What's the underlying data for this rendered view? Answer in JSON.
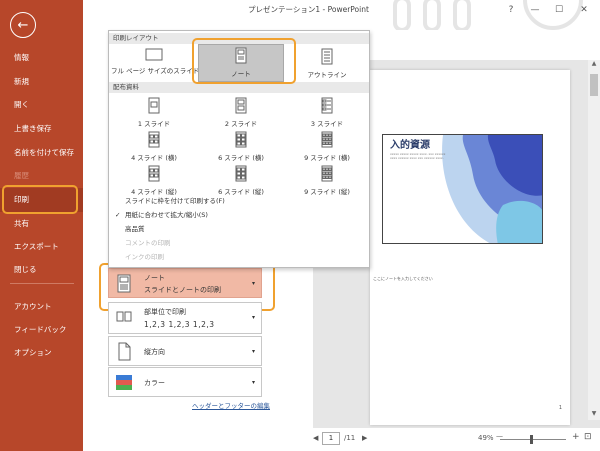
{
  "window": {
    "title": "プレゼンテーション1 - PowerPoint",
    "controls": [
      "?",
      "—",
      "☐",
      "✕"
    ]
  },
  "sidebar": {
    "back_label": "←",
    "items": [
      {
        "label": "情報",
        "state": "normal"
      },
      {
        "label": "新規",
        "state": "normal"
      },
      {
        "label": "開く",
        "state": "normal"
      },
      {
        "label": "上書き保存",
        "state": "normal"
      },
      {
        "label": "名前を付けて保存",
        "state": "normal"
      },
      {
        "label": "履歴",
        "state": "dim"
      },
      {
        "label": "印刷",
        "state": "active"
      },
      {
        "label": "共有",
        "state": "normal"
      },
      {
        "label": "エクスポート",
        "state": "normal"
      },
      {
        "label": "閉じる",
        "state": "normal"
      },
      {
        "label": "アカウント",
        "state": "normal"
      },
      {
        "label": "フィードバック",
        "state": "normal"
      },
      {
        "label": "オプション",
        "state": "normal"
      }
    ]
  },
  "dropdown": {
    "section_layout": "印刷レイアウト",
    "layout_options": [
      {
        "label": "フル ページ サイズのスライド",
        "selected": false
      },
      {
        "label": "ノート",
        "selected": true
      },
      {
        "label": "アウトライン",
        "selected": false
      }
    ],
    "section_handouts": "配布資料",
    "handout_options": [
      {
        "label": "1 スライド"
      },
      {
        "label": "2 スライド"
      },
      {
        "label": "3 スライド"
      },
      {
        "label": "4 スライド (横)"
      },
      {
        "label": "6 スライド (横)"
      },
      {
        "label": "9 スライド (横)"
      },
      {
        "label": "4 スライド (縦)"
      },
      {
        "label": "6 スライド (縦)"
      },
      {
        "label": "9 スライド (縦)"
      }
    ],
    "menu_items": [
      {
        "label": "スライドに枠を付けて印刷する(F)",
        "checked": false,
        "disabled": false
      },
      {
        "label": "用紙に合わせて拡大/縮小(S)",
        "checked": true,
        "disabled": false
      },
      {
        "label": "高品質",
        "checked": false,
        "disabled": false
      },
      {
        "label": "コメントの印刷",
        "checked": false,
        "disabled": true
      },
      {
        "label": "インクの印刷",
        "checked": false,
        "disabled": true
      }
    ]
  },
  "settings": {
    "layout_line1": "ノート",
    "layout_line2": "スライドとノートの印刷",
    "collate_line1": "部単位で印刷",
    "collate_line2": "1,2,3   1,2,3   1,2,3",
    "orientation": "縦方向",
    "color": "カラー",
    "header_footer_link": "ヘッダーとフッターの編集"
  },
  "preview": {
    "slide_title": "入的資源",
    "slide_subtitle": "xxxxx xxxxx xxxxx xxxx. xxx xxxxxx xxxx xxxxxx xxxx xxx xxxxxx xxxx.",
    "note_text": "ここにノートを入力してください",
    "page_number": "1"
  },
  "status": {
    "prev": "◀",
    "current_page": "1",
    "total_pages": "/11",
    "next": "▶",
    "zoom_label": "49%",
    "zoom_minus": "—",
    "zoom_plus": "+",
    "fit_icon": "⊡"
  },
  "colors": {
    "accent": "#b7472a",
    "highlight": "#f0a12f",
    "selected_setting": "#f1b9a5"
  }
}
